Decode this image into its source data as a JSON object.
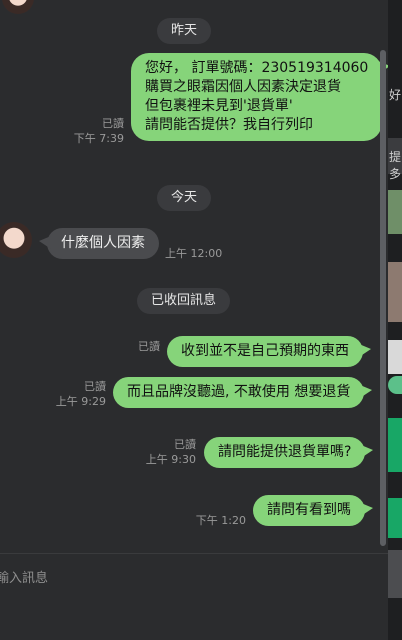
{
  "date_separators": {
    "yesterday": "昨天",
    "today": "今天"
  },
  "recalled": "已收回訊息",
  "messages": [
    {
      "direction": "out",
      "lines": [
        "您好， 訂單號碼：230519314060",
        "購買之眼霜因個人因素決定退貨",
        "但包裹裡未見到'退貨單'",
        "請問能否提供？我自行列印"
      ],
      "read": "已讀",
      "time": "下午 7:39"
    },
    {
      "direction": "in",
      "lines": [
        "什麼個人因素"
      ],
      "time": "上午 12:00"
    },
    {
      "direction": "out",
      "lines": [
        "收到並不是自己預期的東西"
      ],
      "read": "已讀",
      "time": ""
    },
    {
      "direction": "out",
      "lines": [
        "而且品牌沒聽過, 不敢使用 想要退貨"
      ],
      "read": "已讀",
      "time": "上午 9:29"
    },
    {
      "direction": "out",
      "lines": [
        "請問能提供退貨單嗎?"
      ],
      "read": "已讀",
      "time": "上午 9:30"
    },
    {
      "direction": "out",
      "lines": [
        "請問有看到嗎"
      ],
      "read": "",
      "time": "下午 1:20"
    }
  ],
  "input": {
    "placeholder": "輸入訊息"
  },
  "right_pane": {
    "label_top": "好",
    "label_mid": "提多"
  },
  "colors": {
    "bubble_out": "#86d47a",
    "bubble_in": "#4a4b4e",
    "background": "#2b2c2e"
  }
}
